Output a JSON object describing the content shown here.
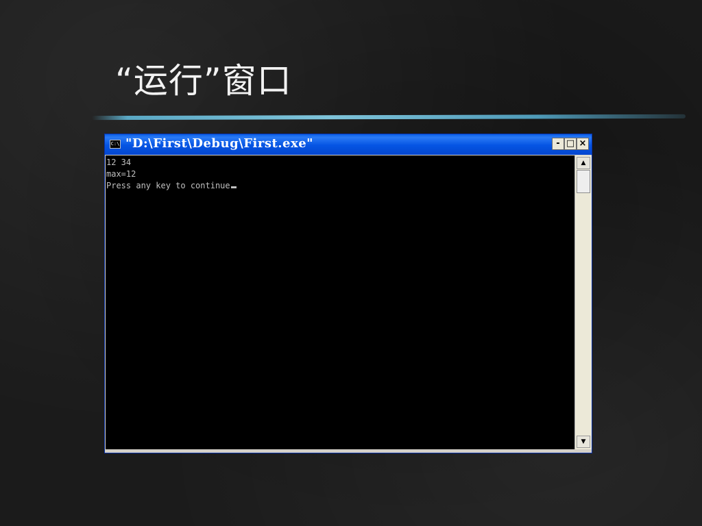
{
  "slide": {
    "title": "“运行”窗口"
  },
  "window": {
    "icon_text": "C:\\",
    "title": "\"D:\\First\\Debug\\First.exe\"",
    "buttons": {
      "minimize": "-",
      "maximize": "□",
      "close": "×"
    }
  },
  "console": {
    "lines": [
      "12 34",
      "max=12",
      "Press any key to continue"
    ]
  },
  "scrollbar": {
    "up_arrow": "▲",
    "down_arrow": "▼"
  },
  "colors": {
    "titlebar": "#0554e3",
    "console_bg": "#000000",
    "console_text": "#c0c0c0",
    "accent_line": "#5aa8c4"
  }
}
